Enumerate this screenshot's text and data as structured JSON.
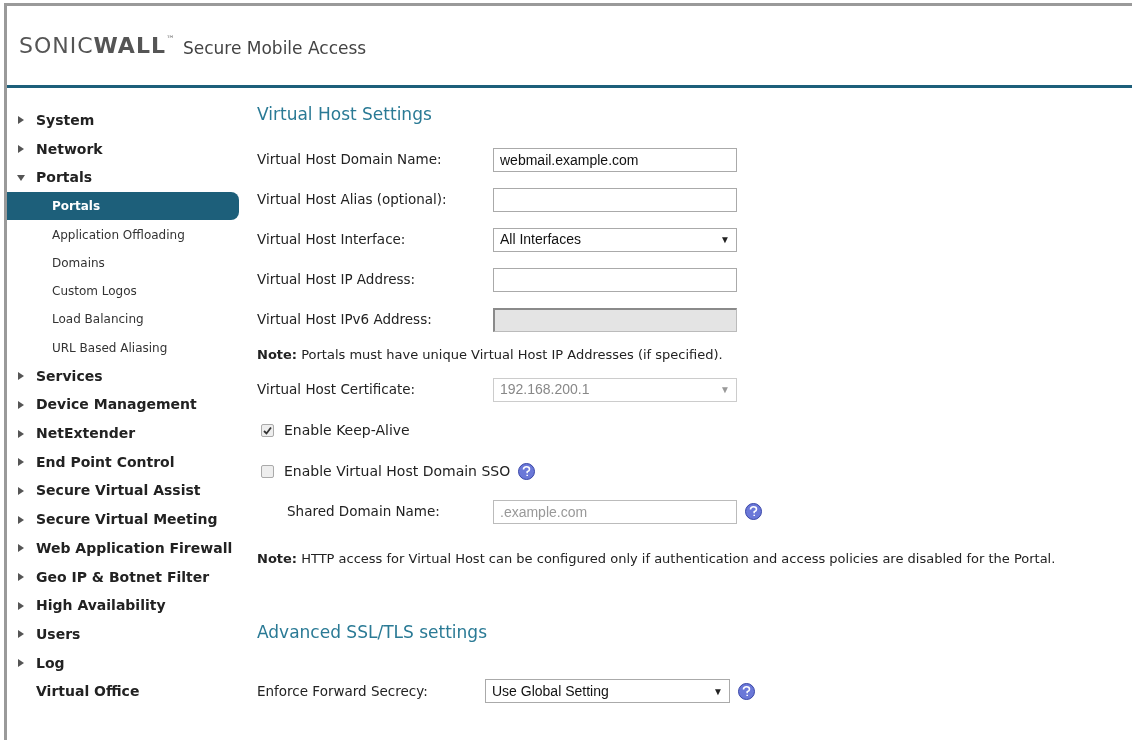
{
  "header": {
    "logo_light": "SONIC",
    "logo_bold": "WALL",
    "trademark": "™",
    "product": "Secure Mobile Access"
  },
  "sidebar": {
    "items": [
      {
        "label": "System",
        "expanded": false,
        "selected": false
      },
      {
        "label": "Network",
        "expanded": false,
        "selected": false
      },
      {
        "label": "Portals",
        "expanded": true,
        "selected": false,
        "children": [
          {
            "label": "Portals",
            "selected": true
          },
          {
            "label": "Application Offloading",
            "selected": false
          },
          {
            "label": "Domains",
            "selected": false
          },
          {
            "label": "Custom Logos",
            "selected": false
          },
          {
            "label": "Load Balancing",
            "selected": false
          },
          {
            "label": "URL Based Aliasing",
            "selected": false
          }
        ]
      },
      {
        "label": "Services",
        "expanded": false,
        "selected": false
      },
      {
        "label": "Device Management",
        "expanded": false,
        "selected": false
      },
      {
        "label": "NetExtender",
        "expanded": false,
        "selected": false
      },
      {
        "label": "End Point Control",
        "expanded": false,
        "selected": false
      },
      {
        "label": "Secure Virtual Assist",
        "expanded": false,
        "selected": false
      },
      {
        "label": "Secure Virtual Meeting",
        "expanded": false,
        "selected": false
      },
      {
        "label": "Web Application Firewall",
        "expanded": false,
        "selected": false
      },
      {
        "label": "Geo IP & Botnet Filter",
        "expanded": false,
        "selected": false
      },
      {
        "label": "High Availability",
        "expanded": false,
        "selected": false
      },
      {
        "label": "Users",
        "expanded": false,
        "selected": false
      },
      {
        "label": "Log",
        "expanded": false,
        "selected": false
      },
      {
        "label": "Virtual Office",
        "selected": false
      }
    ]
  },
  "sections": [
    {
      "title": "Virtual Host Settings",
      "rows": [
        {
          "kind": "text",
          "label": "Virtual Host Domain Name:",
          "value": "webmail.example.com",
          "disabled": false
        },
        {
          "kind": "text",
          "label": "Virtual Host Alias (optional):",
          "disabled": false
        },
        {
          "kind": "select",
          "label": "Virtual Host Interface:",
          "value": "All Interfaces",
          "caret": "▼",
          "disabled": false
        },
        {
          "kind": "text",
          "label": "Virtual Host IP Address:",
          "disabled": false
        },
        {
          "kind": "text",
          "label": "Virtual Host IPv6 Address:",
          "disabled": true
        },
        {
          "kind": "note",
          "text": "**Note:** Portals must have unique Virtual Host IP Addresses (if specified)."
        },
        {
          "kind": "select",
          "label": "Virtual Host Certificate:",
          "value": "192.168.200.1",
          "caret": "▼",
          "disabled": true
        },
        {
          "kind": "checkbox",
          "label": "Enable Keep-Alive",
          "checked": true
        },
        {
          "kind": "checkbox",
          "label": "Enable Virtual Host Domain SSO",
          "checked": false,
          "help": true
        },
        {
          "kind": "text",
          "label": "Shared Domain Name:",
          "placeholder": ".example.com",
          "disabled": true,
          "indent": true,
          "help": true
        },
        {
          "kind": "note",
          "text": "**Note:** HTTP access for Virtual Host can be configured only if authentication and access policies are disabled for the Portal."
        }
      ]
    },
    {
      "title": "Advanced SSL/TLS settings",
      "rows": [
        {
          "kind": "select",
          "label": "Enforce Forward Secrecy:",
          "value": "Use Global Setting",
          "caret": "▼",
          "disabled": false,
          "help": true
        }
      ]
    }
  ]
}
